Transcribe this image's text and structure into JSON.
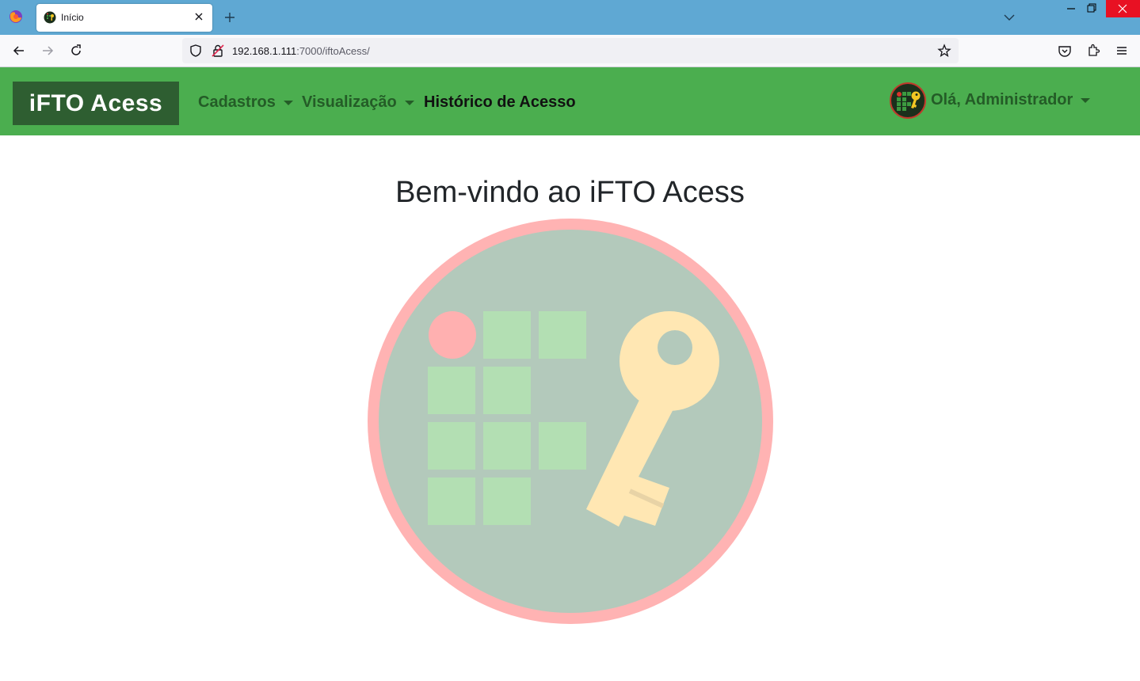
{
  "browser": {
    "tab": {
      "title": "Início"
    },
    "url": {
      "host": "192.168.1.111",
      "rest": ":7000/iftoAcess/"
    }
  },
  "app": {
    "brand": "iFTO Acess",
    "nav": [
      {
        "label": "Cadastros",
        "has_dropdown": true
      },
      {
        "label": "Visualização",
        "has_dropdown": true
      },
      {
        "label": "Histórico de Acesso",
        "has_dropdown": false
      }
    ],
    "user": {
      "greeting": "Olá, Administrador"
    },
    "colors": {
      "header": "#4bae4f",
      "brand_bg": "#2e5e31",
      "nav_text": "#245c27"
    }
  },
  "main": {
    "title": "Bem-vindo ao iFTO Acess",
    "logo_icon": "ifto-key-logo"
  }
}
